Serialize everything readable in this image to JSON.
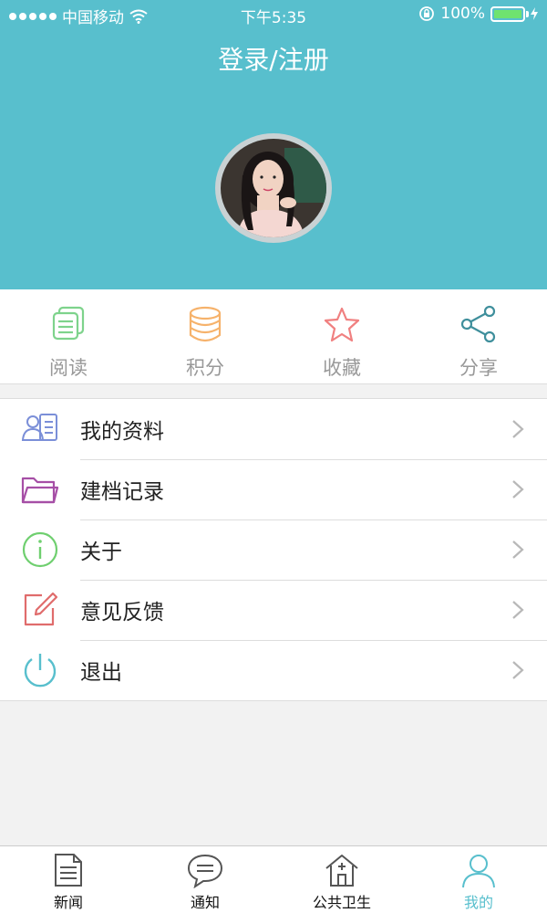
{
  "status_bar": {
    "carrier": "中国移动",
    "time": "下午5:35",
    "battery": "100%"
  },
  "header": {
    "title": "登录/注册"
  },
  "quick_actions": [
    {
      "label": "阅读",
      "icon": "reading-icon",
      "color": "#7ed38c"
    },
    {
      "label": "积分",
      "icon": "coins-icon",
      "color": "#f6b26b"
    },
    {
      "label": "收藏",
      "icon": "star-icon",
      "color": "#f08080"
    },
    {
      "label": "分享",
      "icon": "share-icon",
      "color": "#3f8f9c"
    }
  ],
  "menu": [
    {
      "label": "我的资料",
      "icon": "profile-card-icon",
      "color": "#7b8fd8"
    },
    {
      "label": "建档记录",
      "icon": "folder-icon",
      "color": "#a64fa6"
    },
    {
      "label": "关于",
      "icon": "info-icon",
      "color": "#6fcf6f"
    },
    {
      "label": "意见反馈",
      "icon": "edit-icon",
      "color": "#e06c6c"
    },
    {
      "label": "退出",
      "icon": "power-icon",
      "color": "#58bfcd"
    }
  ],
  "tabbar": [
    {
      "label": "新闻",
      "icon": "news-icon",
      "active": false
    },
    {
      "label": "通知",
      "icon": "chat-icon",
      "active": false
    },
    {
      "label": "公共卫生",
      "icon": "clinic-icon",
      "active": false
    },
    {
      "label": "我的",
      "icon": "person-icon",
      "active": true
    }
  ],
  "colors": {
    "accent": "#58bfcd",
    "background": "#f2f2f2"
  }
}
